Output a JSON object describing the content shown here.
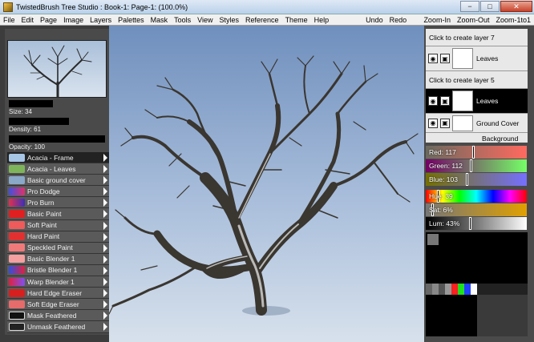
{
  "window": {
    "title": "TwistedBrush Tree Studio : Book-1: Page-1:  (100.0%)",
    "minimize_glyph": "−",
    "maximize_glyph": "□",
    "close_glyph": "✕"
  },
  "menu": {
    "items": [
      "File",
      "Edit",
      "Page",
      "Image",
      "Layers",
      "Palettes",
      "Mask",
      "Tools",
      "View",
      "Styles",
      "Reference",
      "Theme",
      "Help"
    ],
    "actions": [
      "Undo",
      "Redo",
      "Zoom-In",
      "Zoom-Out",
      "Zoom-1to1"
    ]
  },
  "brush_settings": {
    "size_label": "Size: 34",
    "size": 34,
    "density_label": "Density: 61",
    "density": 61,
    "opacity_label": "Opacity: 100",
    "opacity": 100
  },
  "brushes": [
    {
      "label": "Acacia - Frame",
      "color": "#a7c6e6",
      "selected": true
    },
    {
      "label": "Acacia - Leaves",
      "color": "#7fb55a",
      "selected": false
    },
    {
      "label": "Basic ground cover",
      "color": "#8aa8c8",
      "selected": false
    },
    {
      "label": "Pro Dodge",
      "color": "#d93b6f",
      "selected": false
    },
    {
      "label": "Pro Burn",
      "color": "#3d2fb7",
      "selected": false
    },
    {
      "label": "Basic Paint",
      "color": "#e02020",
      "selected": false
    },
    {
      "label": "Soft Paint",
      "color": "#ef5a5a",
      "selected": false
    },
    {
      "label": "Hard Paint",
      "color": "#e23030",
      "selected": false
    },
    {
      "label": "Speckled Paint",
      "color": "#f07a7a",
      "selected": false
    },
    {
      "label": "Basic Blender 1",
      "color": "#f4a0a0",
      "selected": false
    },
    {
      "label": "Bristle Blender 1",
      "color": "#3050e0",
      "selected": false
    },
    {
      "label": "Warp Blender 1",
      "color": "#8050f0",
      "selected": false
    },
    {
      "label": "Hard Edge Eraser",
      "color": "#d81f1f",
      "selected": false
    },
    {
      "label": "Soft Edge Eraser",
      "color": "#e66b6b",
      "selected": false
    },
    {
      "label": "Mask Feathered",
      "color": "#111111",
      "selected": false
    },
    {
      "label": "Unmask Feathered",
      "color": "#222222",
      "selected": false
    }
  ],
  "layers": {
    "create_top": "Click to create layer 7",
    "row1_name": "Leaves",
    "create_mid": "Click to create layer 5",
    "row2_name": "Leaves",
    "row3_name": "Ground Cover",
    "row4_name": "Background",
    "eye_glyph": "◉",
    "lock_glyph": "▣"
  },
  "color": {
    "red_label": "Red: 117",
    "red": 117,
    "green_label": "Green: 112",
    "green": 112,
    "blue_label": "Blue: 103",
    "blue": 103,
    "hue_label": "Hue: 39",
    "hue": 39,
    "sat_label": "Sat: 6%",
    "sat": 6,
    "lum_label": "Lum: 43%",
    "lum": 43
  }
}
